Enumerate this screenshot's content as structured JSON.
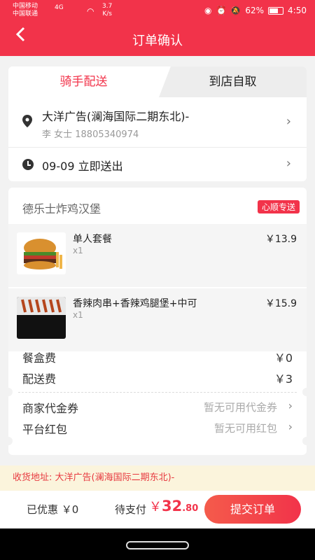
{
  "status_bar": {
    "carrier1": "中国移动",
    "carrier2": "中国联通",
    "network": "4G",
    "speed_value": "3.7",
    "speed_unit": "K/s",
    "battery": "62%",
    "time": "4:50"
  },
  "header": {
    "title": "订单确认",
    "back_icon": "chevron-left-icon"
  },
  "delivery": {
    "tab_rider": "骑手配送",
    "tab_pickup": "到店自取",
    "address_main": "大洋广告(澜海国际二期东北)-",
    "address_contact": "李 女士 18805340974",
    "time": "09-09 立即送出"
  },
  "shop": {
    "name": "德乐士炸鸡汉堡",
    "badge": "心顺专送"
  },
  "items": [
    {
      "name": "单人套餐",
      "qty": "x1",
      "price": "￥13.9"
    },
    {
      "name": "香辣肉串+香辣鸡腿堡+中可",
      "qty": "x1",
      "price": "￥15.9"
    }
  ],
  "fees": {
    "box_label": "餐盒费",
    "box_value": "￥0",
    "delivery_label": "配送费",
    "delivery_value": "￥3"
  },
  "coupons": {
    "merchant_label": "商家代金券",
    "merchant_value": "暂无可用代金券",
    "platform_label": "平台红包",
    "platform_value": "暂无可用红包"
  },
  "address_strip": {
    "label": "收货地址:",
    "value": "大洋广告(澜海国际二期东北)-"
  },
  "bottom": {
    "discount": "已优惠 ￥0",
    "to_pay_label": "待支付",
    "currency": "￥",
    "amount_int": "32",
    "amount_dec": ".80",
    "submit": "提交订单"
  },
  "colors": {
    "accent": "#f2334a",
    "strip_bg": "#fbf4dc"
  }
}
